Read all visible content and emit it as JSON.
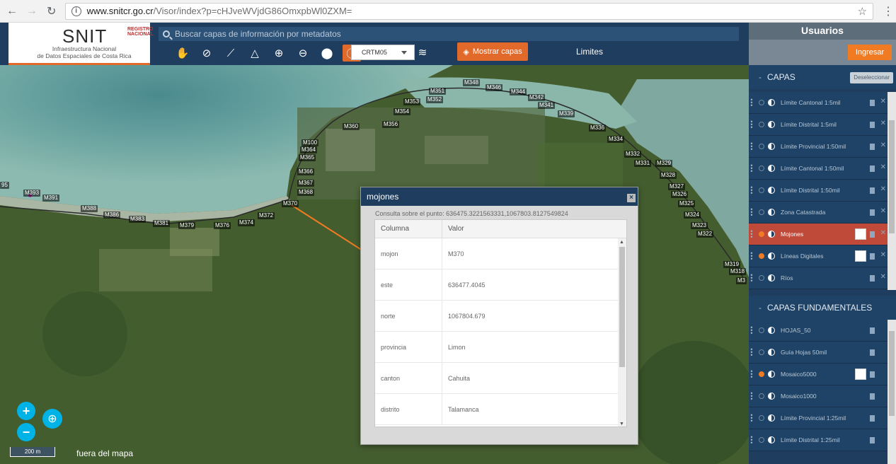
{
  "browser": {
    "url_host": "www.snitcr.go.cr",
    "url_path": "/Visor/index?p=cHJveWVjdG86OmxpbWl0ZXM="
  },
  "header": {
    "logo_title": "SNIT",
    "logo_sub1": "Infraestructura Nacional",
    "logo_sub2": "de Datos Espaciales de Costa Rica",
    "logo_registry": "REGISTRO NACIONAL",
    "search_placeholder": "Buscar capas de información por metadatos",
    "projection": "CRTM05",
    "show_layers": "Mostrar capas",
    "active_project": "Limites"
  },
  "sidebar": {
    "users_title": "Usuarios",
    "login": "Ingresar",
    "capas_title": "CAPAS",
    "deselect": "Deseleccionar",
    "capas": [
      {
        "name": "Límite Cantonal 1:5mil",
        "on": false
      },
      {
        "name": "Límite Distrital 1:5mil",
        "on": false
      },
      {
        "name": "Límite Provincial 1:50mil",
        "on": false
      },
      {
        "name": "Límite Cantonal 1:50mil",
        "on": false
      },
      {
        "name": "Límite Distrital 1:50mil",
        "on": false
      },
      {
        "name": "Zona Catastrada",
        "on": false
      },
      {
        "name": "Mojones",
        "on": true,
        "active": true
      },
      {
        "name": "Líneas Digitales",
        "on": true
      },
      {
        "name": "Ríos",
        "on": false
      }
    ],
    "fundamentales_title": "CAPAS FUNDAMENTALES",
    "fundamentales": [
      {
        "name": "HOJAS_50",
        "on": false
      },
      {
        "name": "Guía Hojas 50mil",
        "on": false
      },
      {
        "name": "Mosaico5000",
        "on": true
      },
      {
        "name": "Mosaico1000",
        "on": false
      },
      {
        "name": "Límite Provincial 1:25mil",
        "on": false
      },
      {
        "name": "Límite Distrital 1:25mil",
        "on": false
      }
    ]
  },
  "popup": {
    "title": "mojones",
    "query": "Consulta sobre el punto: 636475.3221563331,1067803.8127549824",
    "col_header": "Columna",
    "val_header": "Valor",
    "rows": [
      {
        "col": "mojon",
        "val": "M370"
      },
      {
        "col": "este",
        "val": "636477.4045"
      },
      {
        "col": "norte",
        "val": "1067804.679"
      },
      {
        "col": "provincia",
        "val": "Limon"
      },
      {
        "col": "canton",
        "val": "Cahuita"
      },
      {
        "col": "distrito",
        "val": "Talamanca"
      }
    ]
  },
  "map": {
    "scale": "200 m",
    "status": "fuera del mapa",
    "markers": [
      "M393",
      "M391",
      "M388",
      "M386",
      "M383",
      "M381",
      "M379",
      "M376",
      "M374",
      "M372",
      "M370",
      "M368",
      "M367",
      "M366",
      "M365",
      "M364",
      "M100",
      "M360",
      "M356",
      "M354",
      "M353",
      "M352",
      "M351",
      "M348",
      "M346",
      "M344",
      "M342",
      "M341",
      "M339",
      "M336",
      "M334",
      "M332",
      "M331",
      "M329",
      "M328",
      "M327",
      "M326",
      "M325",
      "M324",
      "M323",
      "M322",
      "M319",
      "M318",
      "95",
      "M3"
    ]
  },
  "colors": {
    "navy": "#1f3d5e",
    "accent": "#e16a2a",
    "active_layer": "#bf4a3a",
    "zoom": "#00b3e6"
  }
}
